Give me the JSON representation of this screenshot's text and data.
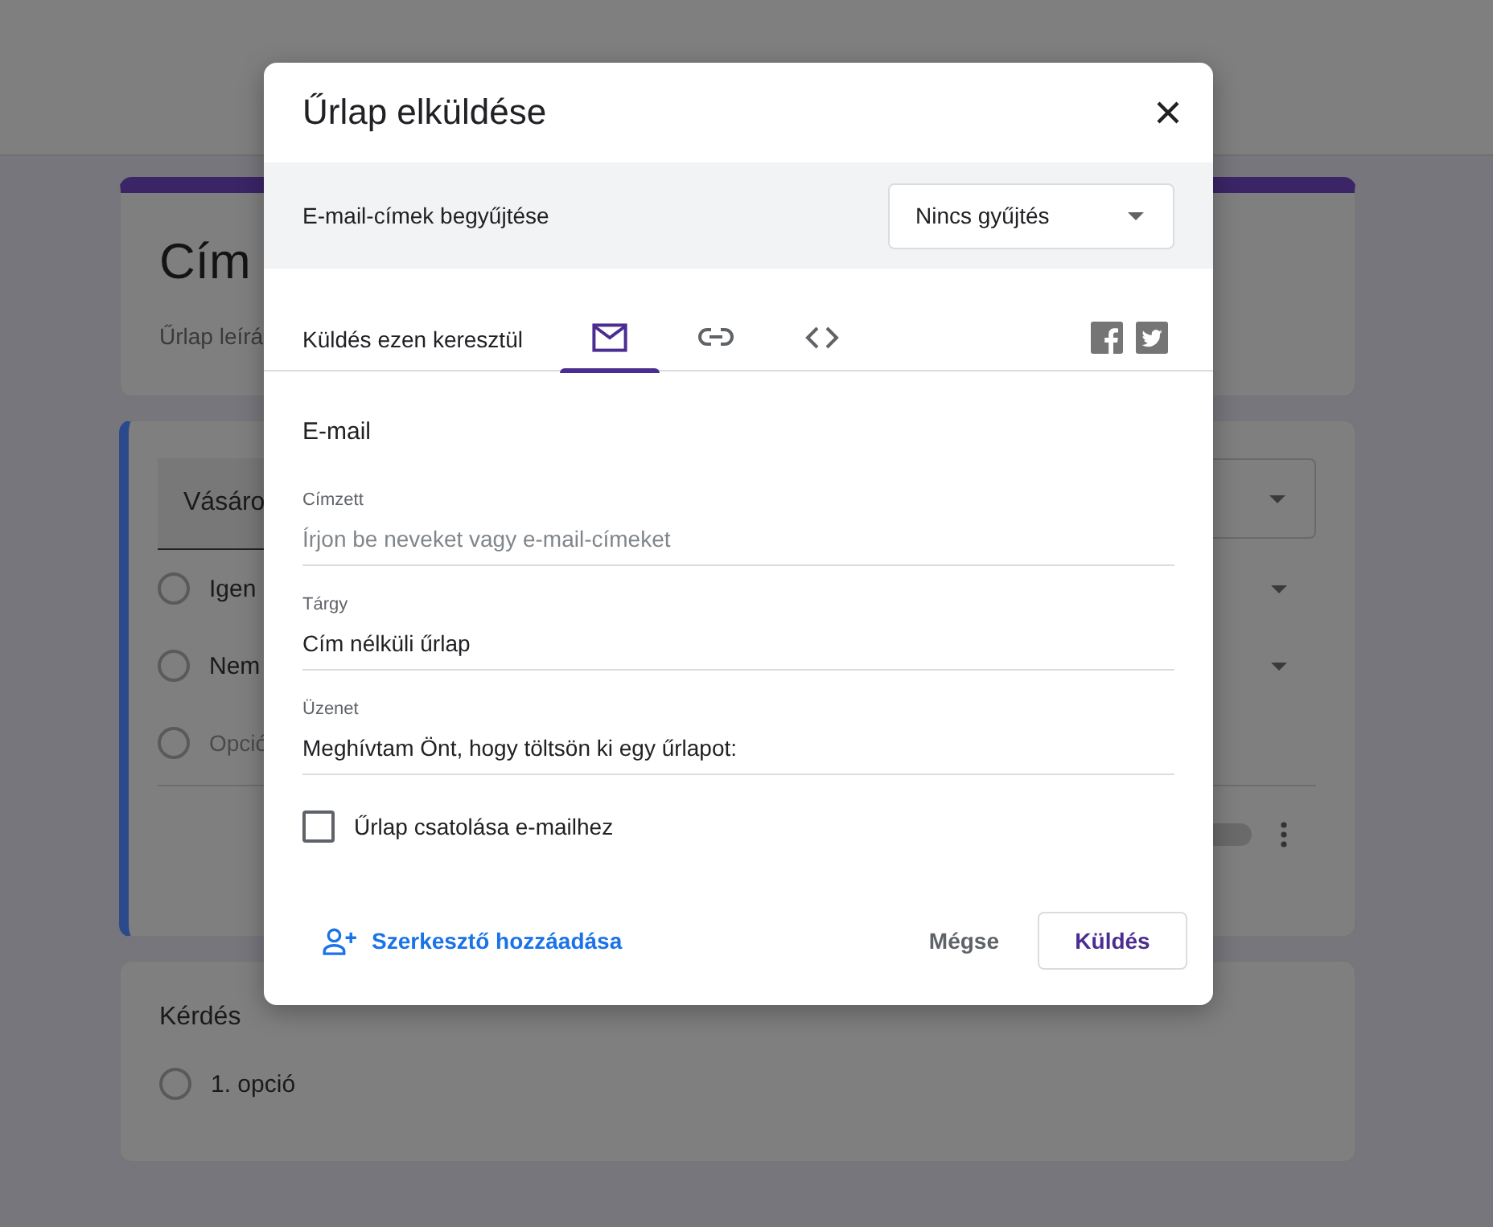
{
  "form": {
    "title": "Cím",
    "description": "Űrlap leírá",
    "questions": [
      {
        "title": "Vásáro",
        "active": true,
        "options": [
          {
            "label": "Igen",
            "kind": "option"
          },
          {
            "label": "Nem",
            "kind": "option"
          },
          {
            "label": "Opció",
            "kind": "add"
          }
        ]
      },
      {
        "title": "Kérdés",
        "active": false,
        "options": [
          {
            "label": "1. opció",
            "kind": "option"
          }
        ]
      }
    ]
  },
  "dialog": {
    "title": "Űrlap elküldése",
    "collect": {
      "label": "E-mail-címek begyűjtése",
      "value": "Nincs gyűjtés"
    },
    "send_via": "Küldés ezen keresztül",
    "tabs": [
      {
        "kind": "email",
        "selected": true
      },
      {
        "kind": "link",
        "selected": false
      },
      {
        "kind": "embed",
        "selected": false
      }
    ],
    "section": "E-mail",
    "fields": [
      {
        "label": "Címzett",
        "placeholder": "Írjon be neveket vagy e-mail-címeket"
      },
      {
        "label": "Tárgy",
        "value": "Cím nélküli űrlap"
      },
      {
        "label": "Üzenet",
        "value": "Meghívtam Önt, hogy töltsön ki egy űrlapot:"
      }
    ],
    "attach": {
      "label": "Űrlap csatolása e-mailhez",
      "checked": false
    },
    "add_editor": "Szerkesztő hozzáadása",
    "cancel": "Mégse",
    "send": "Küldés"
  }
}
